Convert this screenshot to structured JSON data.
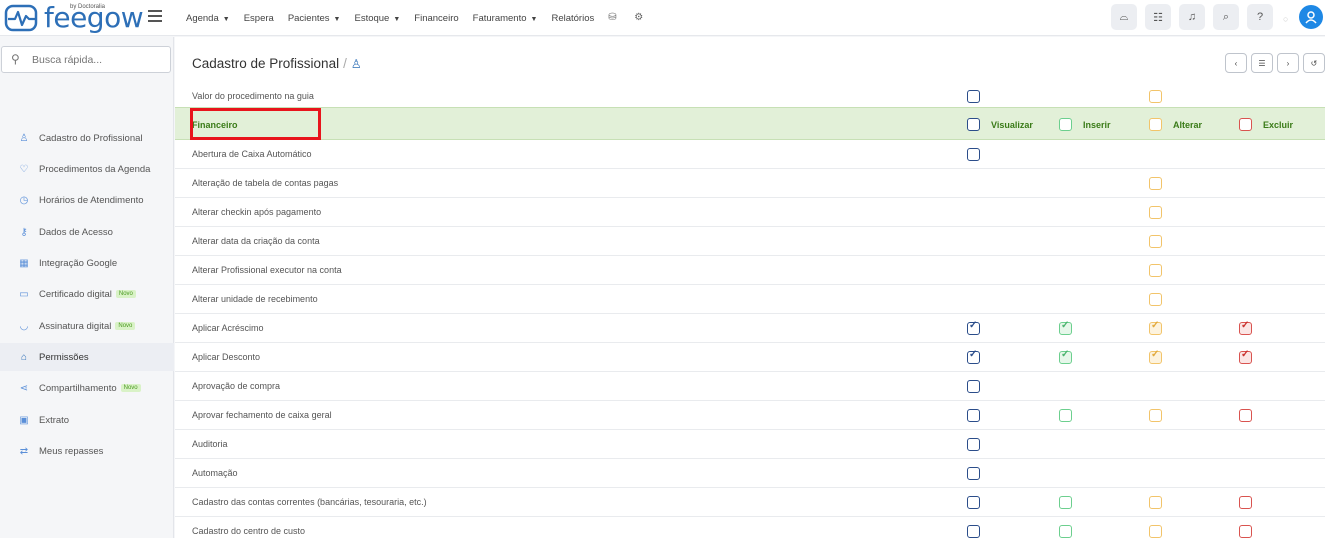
{
  "app": {
    "logo_text": "feegow",
    "logo_sub": "by Doctoralia"
  },
  "nav": [
    {
      "label": "Agenda",
      "caret": true
    },
    {
      "label": "Espera",
      "caret": false
    },
    {
      "label": "Pacientes",
      "caret": true
    },
    {
      "label": "Estoque",
      "caret": true
    },
    {
      "label": "Financeiro",
      "caret": false
    },
    {
      "label": "Faturamento",
      "caret": true
    },
    {
      "label": "Relatórios",
      "caret": false
    }
  ],
  "search": {
    "placeholder": "Busca rápida..."
  },
  "sidebar": {
    "items": [
      {
        "label": "Cadastro do Profissional",
        "icon": "user-icon",
        "glyph": "♙"
      },
      {
        "label": "Procedimentos da Agenda",
        "icon": "stethoscope-icon",
        "glyph": "♡"
      },
      {
        "label": "Horários de Atendimento",
        "icon": "clock-icon",
        "glyph": "◷"
      },
      {
        "label": "Dados de Acesso",
        "icon": "key-icon",
        "glyph": "⚷"
      },
      {
        "label": "Integração Google",
        "icon": "calendar-icon",
        "glyph": "▦"
      },
      {
        "label": "Certificado digital",
        "icon": "card-icon",
        "glyph": "▭",
        "badge": "Novo"
      },
      {
        "label": "Assinatura digital",
        "icon": "shield-icon",
        "glyph": "◡",
        "badge": "Novo"
      },
      {
        "label": "Permissões",
        "icon": "lock-icon",
        "glyph": "⌂",
        "active": true
      },
      {
        "label": "Compartilhamento",
        "icon": "share-icon",
        "glyph": "⋖",
        "badge": "Novo"
      },
      {
        "label": "Extrato",
        "icon": "money-icon",
        "glyph": "▣"
      },
      {
        "label": "Meus repasses",
        "icon": "transfer-icon",
        "glyph": "⇄"
      }
    ]
  },
  "page": {
    "title": "Cadastro de Profissional",
    "separator": "/"
  },
  "columns": {
    "visualizar": "Visualizar",
    "inserir": "Inserir",
    "alterar": "Alterar",
    "excluir": "Excluir"
  },
  "section": {
    "label": "Financeiro"
  },
  "rows": [
    {
      "label": "Valor do procedimento na guia",
      "v": false,
      "a": false
    },
    {
      "label": "Abertura de Caixa Automático",
      "v": false
    },
    {
      "label": "Alteração de tabela de contas pagas",
      "a": false
    },
    {
      "label": "Alterar checkin após pagamento",
      "a": false
    },
    {
      "label": "Alterar data da criação da conta",
      "a": false
    },
    {
      "label": "Alterar Profissional executor na conta",
      "a": false
    },
    {
      "label": "Alterar unidade de recebimento",
      "a": false
    },
    {
      "label": "Aplicar Acréscimo",
      "v": true,
      "i": true,
      "a": true,
      "e": true
    },
    {
      "label": "Aplicar Desconto",
      "v": true,
      "i": true,
      "a": true,
      "e": true
    },
    {
      "label": "Aprovação de compra",
      "v": false
    },
    {
      "label": "Aprovar fechamento de caixa geral",
      "v": false,
      "i": false,
      "a": false,
      "e": false
    },
    {
      "label": "Auditoria",
      "v": false
    },
    {
      "label": "Automação",
      "v": false
    },
    {
      "label": "Cadastro das contas correntes (bancárias, tesouraria, etc.)",
      "v": false,
      "i": false,
      "a": false,
      "e": false
    },
    {
      "label": "Cadastro do centro de custo",
      "v": false,
      "i": false,
      "a": false,
      "e": false
    }
  ]
}
